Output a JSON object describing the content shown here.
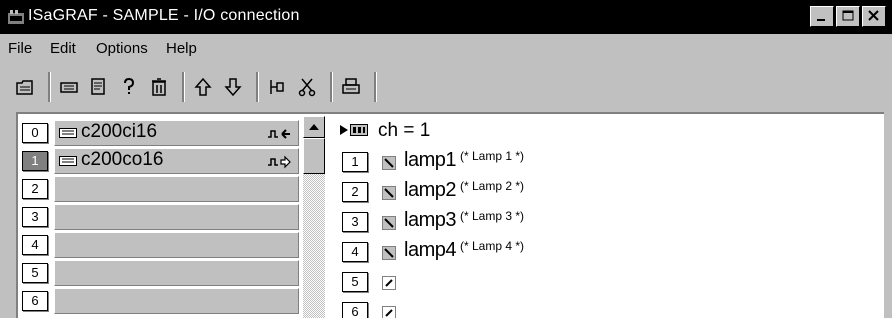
{
  "window": {
    "title": "ISaGRAF - SAMPLE - I/O connection"
  },
  "menu": [
    {
      "label": "File"
    },
    {
      "label": "Edit"
    },
    {
      "label": "Options"
    },
    {
      "label": "Help"
    }
  ],
  "toolbar": {
    "icons": [
      "open-icon",
      "board-icon",
      "properties-icon",
      "help-icon",
      "delete-icon",
      "move-up-icon",
      "move-down-icon",
      "connect-icon",
      "disconnect-icon",
      "print-icon"
    ]
  },
  "boards": [
    {
      "slot": "0",
      "name": "c200ci16",
      "selected": false,
      "direction": "input"
    },
    {
      "slot": "1",
      "name": "c200co16",
      "selected": true,
      "direction": "output"
    },
    {
      "slot": "2",
      "name": ""
    },
    {
      "slot": "3",
      "name": ""
    },
    {
      "slot": "4",
      "name": ""
    },
    {
      "slot": "5",
      "name": ""
    },
    {
      "slot": "6",
      "name": ""
    }
  ],
  "channel_panel": {
    "header": "ch = 1",
    "rows": [
      {
        "num": "1",
        "name": "lamp1",
        "comment": "(* Lamp 1 *)"
      },
      {
        "num": "2",
        "name": "lamp2",
        "comment": "(* Lamp 2 *)"
      },
      {
        "num": "3",
        "name": "lamp3",
        "comment": "(* Lamp 3 *)"
      },
      {
        "num": "4",
        "name": "lamp4",
        "comment": "(* Lamp 4 *)"
      },
      {
        "num": "5",
        "name": "",
        "comment": ""
      },
      {
        "num": "6",
        "name": "",
        "comment": ""
      }
    ]
  },
  "colors": {
    "face": "#c0c0c0",
    "titlebar": "#000000",
    "shadow": "#808080"
  }
}
